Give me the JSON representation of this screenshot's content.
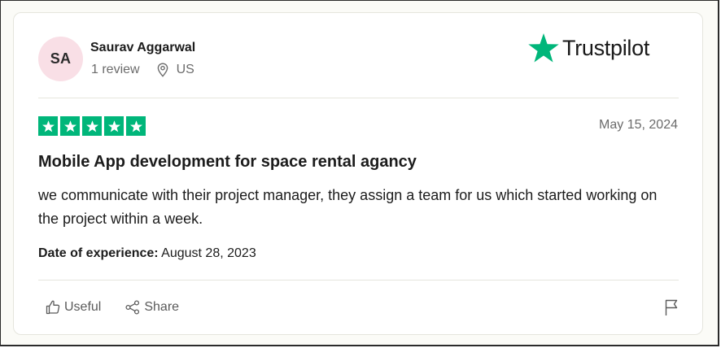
{
  "reviewer": {
    "initials": "SA",
    "name": "Saurav Aggarwal",
    "review_count": "1 review",
    "location": "US"
  },
  "brand": {
    "name": "Trustpilot",
    "star_color": "#00b67a"
  },
  "review": {
    "rating": 5,
    "date": "May 15, 2024",
    "title": "Mobile App development for space rental agancy",
    "body": "we communicate with their project manager, they assign a team for us which started working on the project within a week.",
    "experience_label": "Date of experience:",
    "experience_date": "August 28, 2023"
  },
  "actions": {
    "useful_label": "Useful",
    "share_label": "Share"
  },
  "icons": [
    "location-pin-icon",
    "trustpilot-star-icon",
    "star-icon",
    "thumbs-up-icon",
    "share-icon",
    "flag-icon"
  ]
}
